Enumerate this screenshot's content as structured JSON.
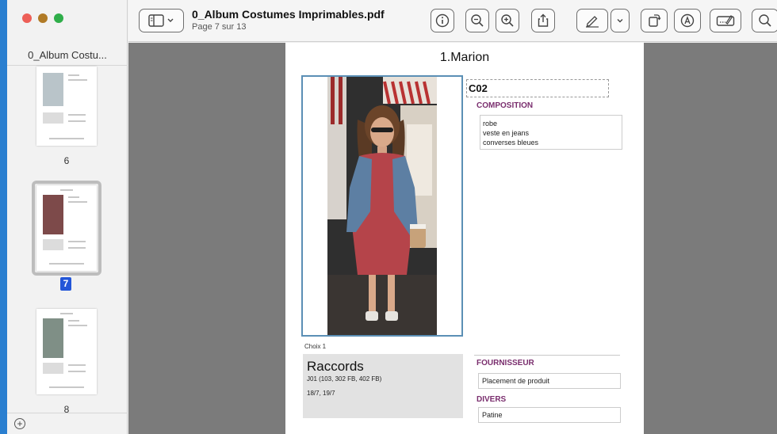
{
  "sidebar": {
    "title": "0_Album Costu...",
    "pages": [
      {
        "number": "6"
      },
      {
        "number": "7"
      },
      {
        "number": "8"
      }
    ]
  },
  "toolbar": {
    "doc_title": "0_Album Costumes Imprimables.pdf",
    "page_indicator": "Page 7 sur 13"
  },
  "page": {
    "title": "1.Marion",
    "code": "C02",
    "composition_label": "COMPOSITION",
    "composition_items": [
      "robe",
      "veste en jeans",
      "converses bleues"
    ],
    "choix": "Choix 1",
    "raccords_title": "Raccords",
    "raccords_line1": "J01 (103, 302 FB, 402 FB)",
    "raccords_line2": "18/7, 19/7",
    "fournisseur_label": "FOURNISSEUR",
    "fournisseur_value": "Placement de produit",
    "divers_label": "DIVERS",
    "divers_value": "Patine"
  }
}
